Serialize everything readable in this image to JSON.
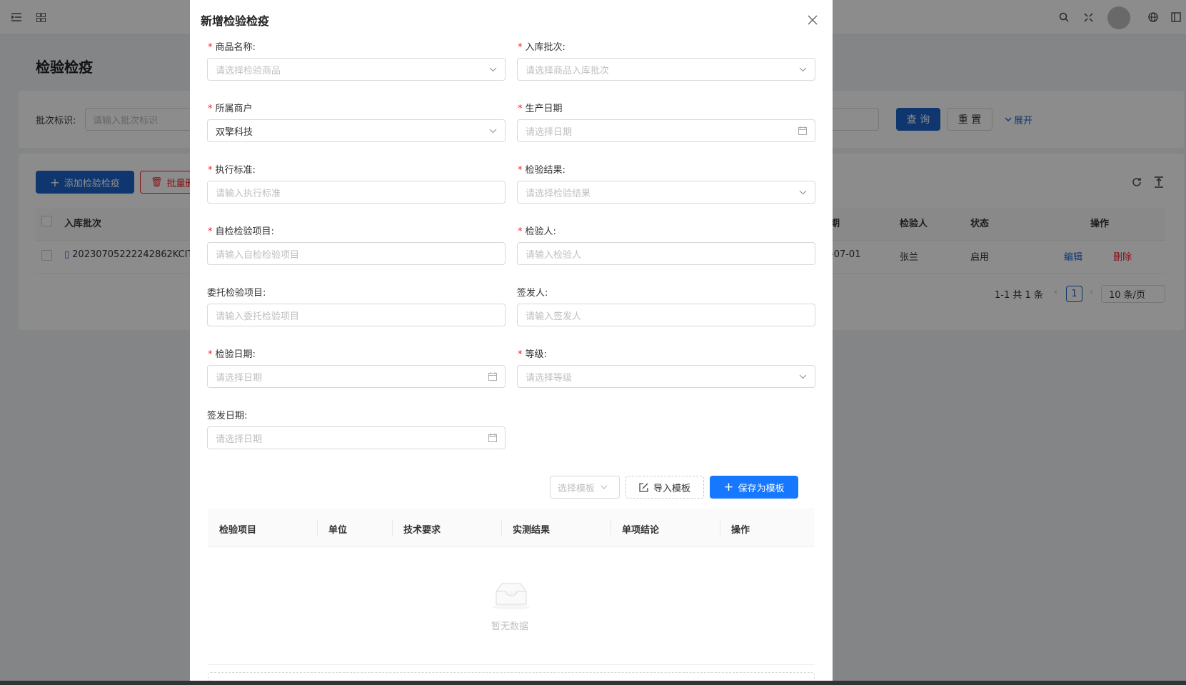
{
  "background_page": {
    "title": "检验检疫",
    "search": {
      "batch_label": "批次标识:",
      "batch_placeholder": "请输入批次标识",
      "query_button": "查 询",
      "reset_button": "重 置",
      "expand_link": "展开"
    },
    "toolbar": {
      "add_button": "添加检验检疫",
      "batch_button": "批量删"
    },
    "table": {
      "col_batch": "入库批次",
      "col_date_suffix": "期",
      "col_inspector": "检验人",
      "col_status": "状态",
      "col_actions": "操作",
      "row": {
        "batch": "20230705222242862KCIT",
        "date_suffix": "-07-01",
        "inspector": "张兰",
        "status": "启用",
        "edit": "编辑",
        "delete": "删除"
      }
    },
    "pagination": {
      "summary": "1-1 共 1 条",
      "current_page": "1",
      "page_size": "10 条/页"
    }
  },
  "modal": {
    "title": "新增检验检疫",
    "fields": {
      "product_name": {
        "label": "商品名称:",
        "placeholder": "请选择检验商品"
      },
      "inbound_batch": {
        "label": "入库批次:",
        "placeholder": "请选择商品入库批次"
      },
      "merchant": {
        "label": "所属商户",
        "value": "双擎科技"
      },
      "production_date": {
        "label": "生产日期",
        "placeholder": "请选择日期"
      },
      "standard": {
        "label": "执行标准:",
        "placeholder": "请输入执行标准"
      },
      "result": {
        "label": "检验结果:",
        "placeholder": "请选择检验结果"
      },
      "self_items": {
        "label": "自检检验项目:",
        "placeholder": "请输入自检检验项目"
      },
      "inspector": {
        "label": "检验人:",
        "placeholder": "请输入检验人"
      },
      "entrusted_items": {
        "label": "委托检验项目:",
        "placeholder": "请输入委托检验项目"
      },
      "issuer": {
        "label": "签发人:",
        "placeholder": "请输入签发人"
      },
      "inspection_date": {
        "label": "检验日期:",
        "placeholder": "请选择日期"
      },
      "grade": {
        "label": "等级:",
        "placeholder": "请选择等级"
      },
      "issue_date": {
        "label": "签发日期:",
        "placeholder": "请选择日期"
      }
    },
    "required_mark": "*",
    "template": {
      "select_placeholder": "选择模板",
      "import_button": "导入模板",
      "save_button": "保存为模板"
    },
    "items_table": {
      "columns": [
        "检验项目",
        "单位",
        "技术要求",
        "实测结果",
        "单项结论",
        "操作"
      ],
      "empty_text": "暂无数据"
    }
  },
  "colors": {
    "primary": "#1c63c9",
    "save_button": "#1677ff",
    "required": "#f5222d",
    "delete_link": "#f5222d"
  }
}
